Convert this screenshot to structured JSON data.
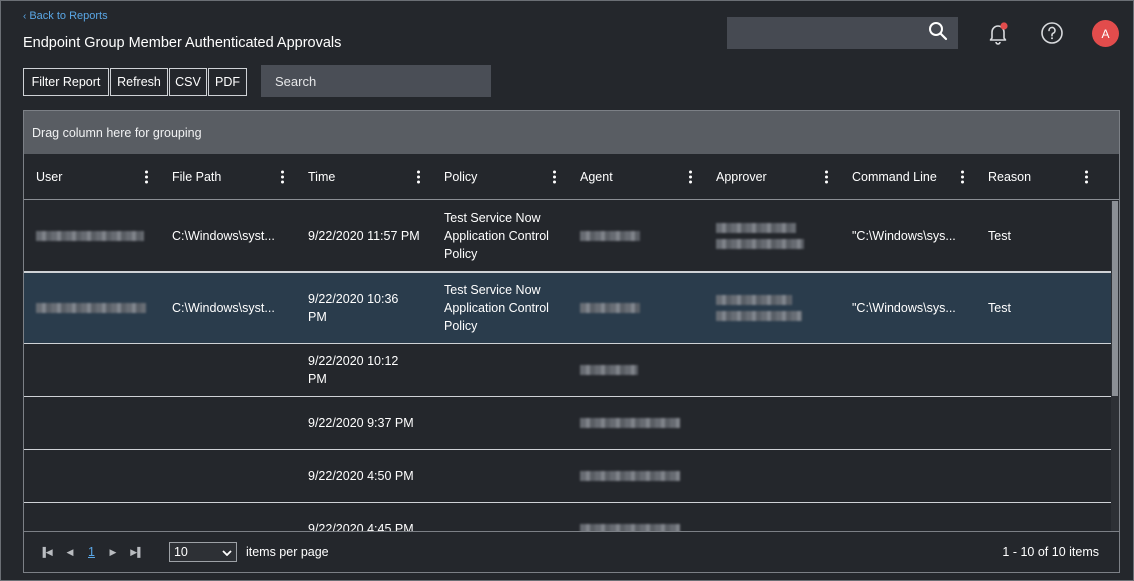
{
  "nav": {
    "back_label": "Back to Reports"
  },
  "page": {
    "title": "Endpoint Group Member Authenticated Approvals"
  },
  "header": {
    "avatar_initial": "A"
  },
  "toolbar": {
    "filter_label": "Filter Report",
    "refresh_label": "Refresh",
    "csv_label": "CSV",
    "pdf_label": "PDF"
  },
  "search": {
    "placeholder": "Search"
  },
  "grid": {
    "group_hint": "Drag column here for grouping",
    "columns": [
      "User",
      "File Path",
      "Time",
      "Policy",
      "Agent",
      "Approver",
      "Command Line",
      "Reason"
    ],
    "rows": [
      {
        "file_path": "C:\\Windows\\syst...",
        "time": "9/22/2020 11:57 PM",
        "policy": "Test Service Now Application Control Policy",
        "command_line": "\"C:\\Windows\\sys...",
        "reason": "Test"
      },
      {
        "file_path": "C:\\Windows\\syst...",
        "time": "9/22/2020 10:36 PM",
        "policy": "Test Service Now Application Control Policy",
        "command_line": "\"C:\\Windows\\sys...",
        "reason": "Test"
      },
      {
        "file_path": "",
        "time": "9/22/2020 10:12 PM",
        "policy": "",
        "command_line": "",
        "reason": ""
      },
      {
        "file_path": "",
        "time": "9/22/2020 9:37 PM",
        "policy": "",
        "command_line": "",
        "reason": ""
      },
      {
        "file_path": "",
        "time": "9/22/2020 4:50 PM",
        "policy": "",
        "command_line": "",
        "reason": ""
      },
      {
        "file_path": "",
        "time": "9/22/2020 4:45 PM",
        "policy": "",
        "command_line": "",
        "reason": ""
      }
    ]
  },
  "pager": {
    "current_page": "1",
    "page_size": "10",
    "items_per_page_label": "items per page",
    "count_label": "1 - 10 of 10 items"
  },
  "colors": {
    "accent": "#5aa7e6",
    "avatar": "#e24c4c",
    "selected_row": "#2a3c4c",
    "notification_dot": "#e24c4c"
  }
}
